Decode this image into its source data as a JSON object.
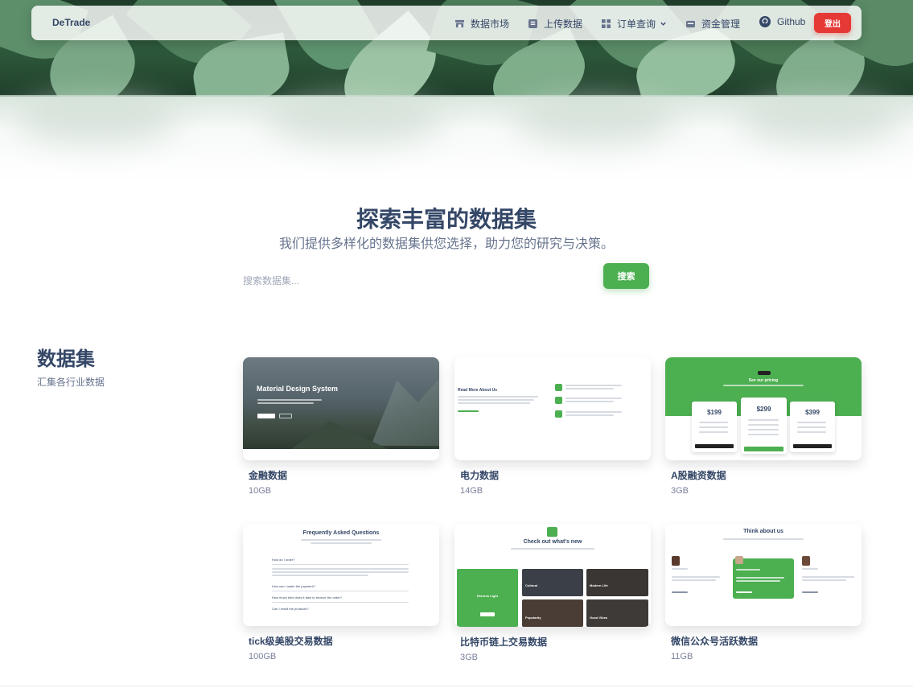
{
  "navbar": {
    "brand": "DeTrade",
    "items": [
      {
        "label": "数据市场",
        "icon": "store-icon"
      },
      {
        "label": "上传数据",
        "icon": "upload-icon"
      },
      {
        "label": "订单查询",
        "icon": "grid-icon"
      },
      {
        "label": "资金管理",
        "icon": "wallet-icon"
      },
      {
        "label": "Github",
        "icon": "github-icon"
      }
    ],
    "logout": "登出"
  },
  "explore": {
    "title": "探索丰富的数据集",
    "subtitle": "我们提供多样化的数据集供您选择，助力您的研究与决策。",
    "search_placeholder": "搜索数据集...",
    "search_button": "搜索"
  },
  "datasets": {
    "title": "数据集",
    "subtitle": "汇集各行业数据",
    "cards": [
      {
        "name": "金融数据",
        "size": "10GB"
      },
      {
        "name": "电力数据",
        "size": "14GB"
      },
      {
        "name": "A股融资数据",
        "size": "3GB"
      },
      {
        "name": "tick级美股交易数据",
        "size": "100GB"
      },
      {
        "name": "比特币链上交易数据",
        "size": "3GB"
      },
      {
        "name": "微信公众号活跃数据",
        "size": "11GB"
      }
    ],
    "thumbs": {
      "material": {
        "title": "Material Design System"
      },
      "about": {
        "title": "Read More About Us"
      },
      "pricing": {
        "title": "See our pricing",
        "prices": [
          "$199",
          "$299",
          "$399"
        ]
      },
      "faq": {
        "title": "Frequently Asked Questions",
        "questions": [
          "How do I order?",
          "How can i make the payment?",
          "How much time does it take to receive the order?",
          "Can I resell the products?"
        ]
      },
      "new": {
        "title": "Check out what's new",
        "tiles": [
          "Returns Light",
          "Cultural",
          "Modern Life",
          "Popularity",
          "Good Vibes"
        ]
      },
      "think": {
        "title": "Think about us"
      }
    }
  }
}
